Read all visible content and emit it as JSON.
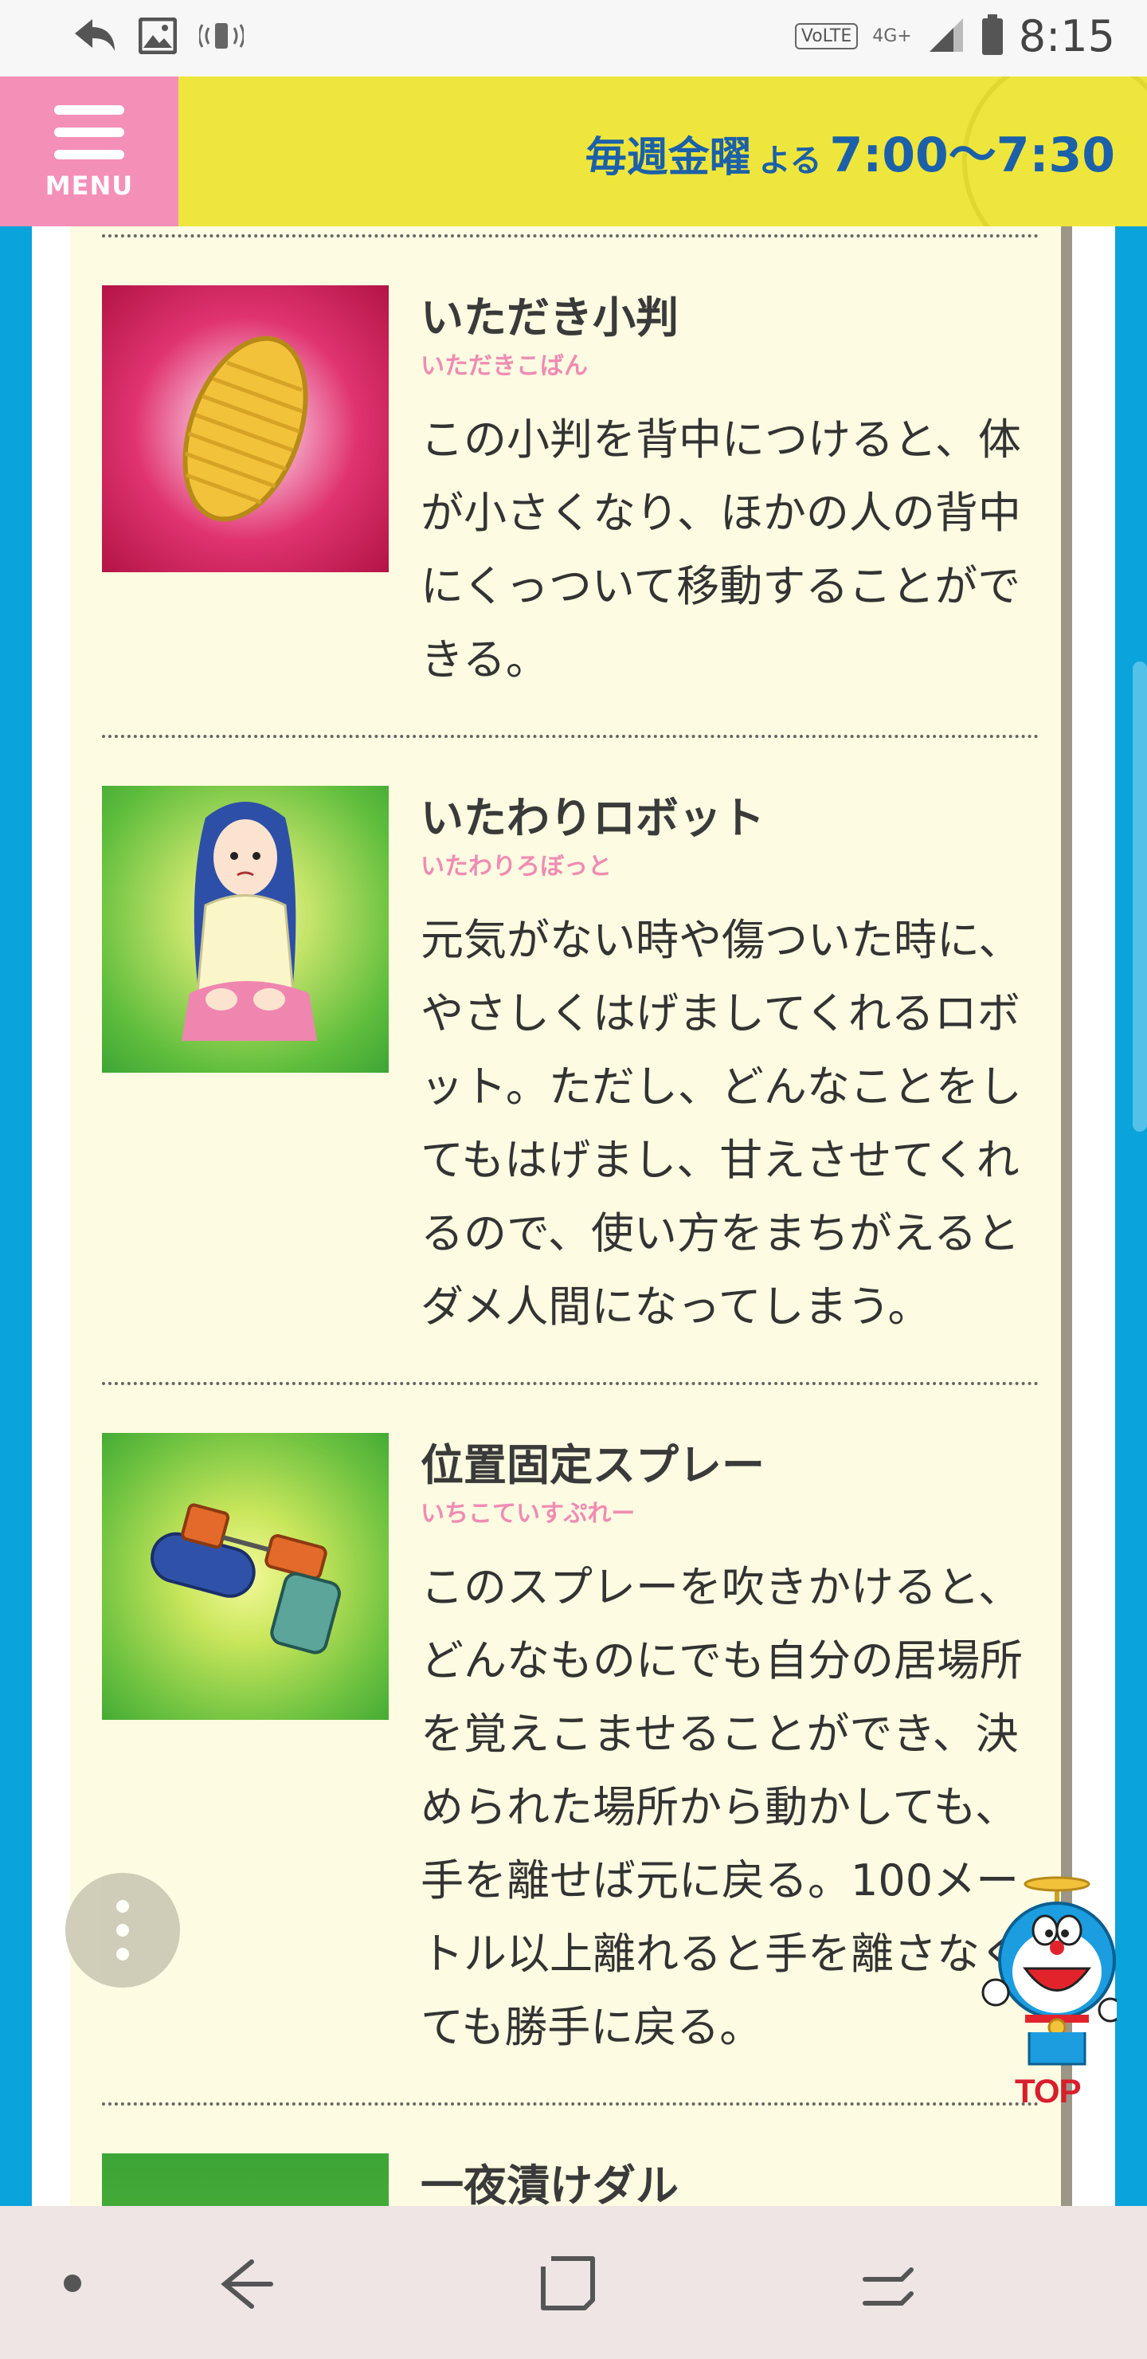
{
  "status_bar": {
    "time": "8:15",
    "network": "4G+",
    "volte": "VoLTE",
    "icons": [
      "back-arrow-icon",
      "image-icon",
      "vibrate-icon",
      "signal-icon",
      "battery-icon"
    ]
  },
  "header": {
    "menu_label": "MENU",
    "air_days": "毎週金曜",
    "air_yoru": "よる",
    "air_time": "7:00〜7:30"
  },
  "items": [
    {
      "title": "いただき小判",
      "reading": "いただきこばん",
      "description": "この小判を背中につけると、体が小さくなり、ほかの人の背中にくっついて移動することができる。",
      "image": "gold-coin-koban-image"
    },
    {
      "title": "いたわりロボット",
      "reading": "いたわりろぼっと",
      "description": "元気がない時や傷ついた時に、やさしくはげましてくれるロボット。ただし、どんなことをしてもはげまし、甘えさせてくれるので、使い方をまちがえるとダメ人間になってしまう。",
      "image": "kneeling-woman-robot-image"
    },
    {
      "title": "位置固定スプレー",
      "reading": "いちこていすぷれー",
      "description": "このスプレーを吹きかけると、どんなものにでも自分の居場所を覚えこませることができ、決められた場所から動かしても、手を離せば元に戻る。100メートル以上離れると手を離さなくても勝手に戻る。",
      "image": "spray-gadget-image"
    },
    {
      "title": "一夜漬けダル",
      "reading": "",
      "description": "",
      "image": "green-background-image"
    }
  ],
  "floating": {
    "top_label": "TOP"
  },
  "colors": {
    "header_yellow": "#eee63c",
    "menu_pink": "#f48fb8",
    "brand_blue": "#1b60a8",
    "side_blue": "#0aa3dc",
    "panel_cream": "#fdfbe1",
    "reading_pink": "#ef8cb3"
  }
}
